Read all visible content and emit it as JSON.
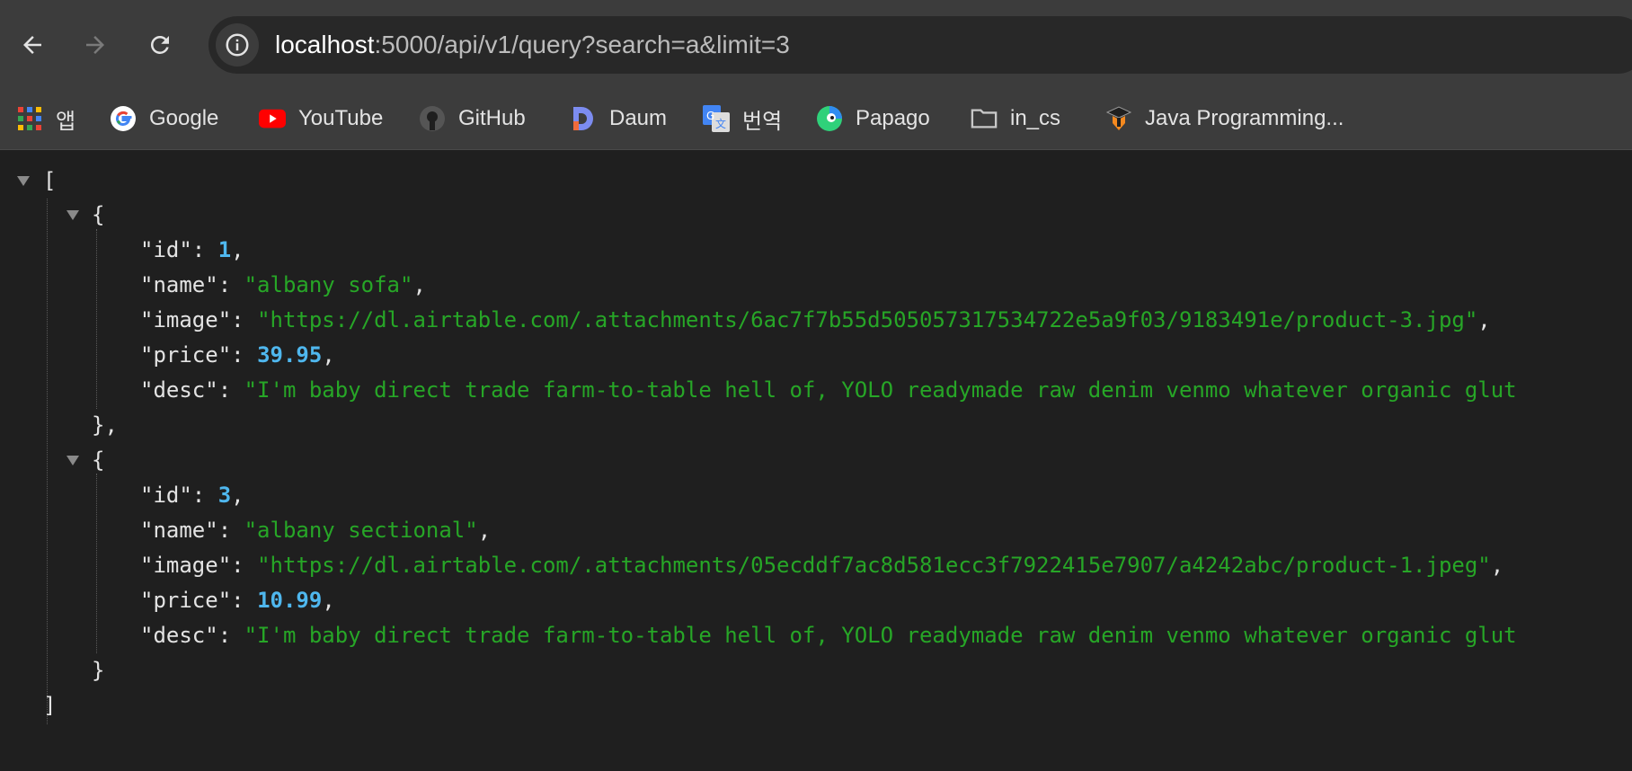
{
  "browser": {
    "url_host": "localhost",
    "url_rest": ":5000/api/v1/query?search=a&limit=3"
  },
  "bookmarks": [
    {
      "label": "앱",
      "icon": "apps-grid-icon"
    },
    {
      "label": "Google",
      "icon": "google-icon"
    },
    {
      "label": "YouTube",
      "icon": "youtube-icon"
    },
    {
      "label": "GitHub",
      "icon": "github-icon"
    },
    {
      "label": "Daum",
      "icon": "daum-icon"
    },
    {
      "label": "번역",
      "icon": "translate-icon"
    },
    {
      "label": "Papago",
      "icon": "papago-icon"
    },
    {
      "label": "in_cs",
      "icon": "folder-icon"
    },
    {
      "label": "Java Programming...",
      "icon": "java-programming-icon"
    }
  ],
  "json": {
    "open_bracket": "[",
    "close_bracket": "]",
    "items": [
      {
        "id_key": "\"id\"",
        "id_value": "1",
        "name_key": "\"name\"",
        "name_value": "\"albany sofa\"",
        "image_key": "\"image\"",
        "image_value": "\"https://dl.airtable.com/.attachments/6ac7f7b55d505057317534722e5a9f03/9183491e/product-3.jpg\"",
        "price_key": "\"price\"",
        "price_value": "39.95",
        "desc_key": "\"desc\"",
        "desc_value": "\"I'm baby direct trade farm-to-table hell of, YOLO readymade raw denim venmo whatever organic glut",
        "close": "},"
      },
      {
        "id_key": "\"id\"",
        "id_value": "3",
        "name_key": "\"name\"",
        "name_value": "\"albany sectional\"",
        "image_key": "\"image\"",
        "image_value": "\"https://dl.airtable.com/.attachments/05ecddf7ac8d581ecc3f7922415e7907/a4242abc/product-1.jpeg\"",
        "price_key": "\"price\"",
        "price_value": "10.99",
        "desc_key": "\"desc\"",
        "desc_value": "\"I'm baby direct trade farm-to-table hell of, YOLO readymade raw denim venmo whatever organic glut",
        "close": "}"
      }
    ]
  }
}
